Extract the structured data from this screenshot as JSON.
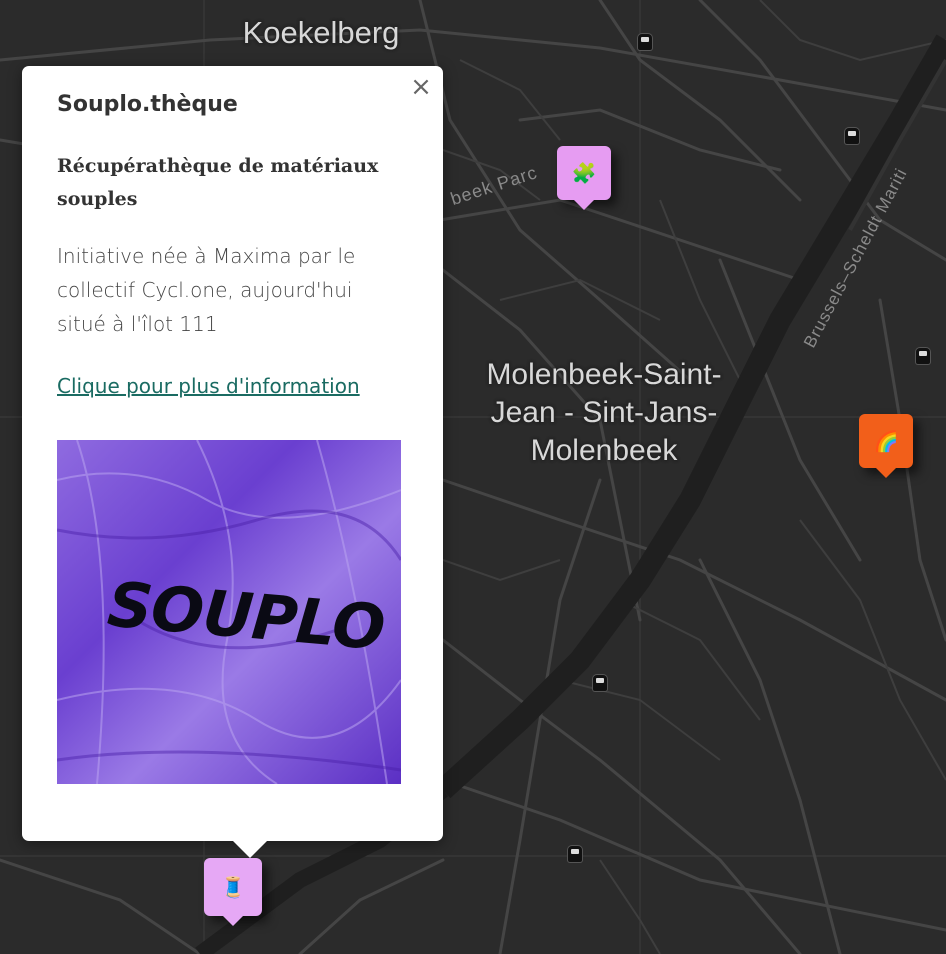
{
  "map": {
    "place_labels": {
      "koekelberg": "Koekelberg",
      "molenbeek": "Molenbeek-Saint-Jean - Sint-Jans-Molenbeek",
      "molenbeek_line1": "Molenbeek-Saint-",
      "molenbeek_line2": "Jean - Sint-Jans-",
      "molenbeek_line3": "Molenbeek"
    },
    "street_labels": {
      "street1": "beek Parc",
      "street2": "Brussels–Scheldt Mariti"
    },
    "background_color": "#2b2b2b",
    "markers": [
      {
        "name": "puzzle-marker",
        "icon": "puzzle-piece-icon",
        "glyph": "🧩",
        "color": "#e69cf2"
      },
      {
        "name": "rainbow-marker",
        "icon": "rainbow-icon",
        "glyph": "🌈",
        "color": "#f25f1a"
      },
      {
        "name": "thread-marker",
        "icon": "sewing-thread-icon",
        "glyph": "🧵",
        "color": "#e6a8f5"
      }
    ],
    "transit_icons": [
      "bus-icon",
      "bus-icon",
      "bus-icon",
      "bus-icon",
      "bus-icon",
      "bus-icon"
    ]
  },
  "popup": {
    "title": "Souplo.thèque",
    "subtitle": "Récupérathèque de matériaux souples",
    "description": "Initiative née à Maxima par le collectif Cycl.one, aujourd'hui situé à l'îlot 111",
    "link_text": "Clique pour plus d'information",
    "close_symbol": "×",
    "image_text": "SOUPLO",
    "image_color": "#7b4fd6"
  }
}
